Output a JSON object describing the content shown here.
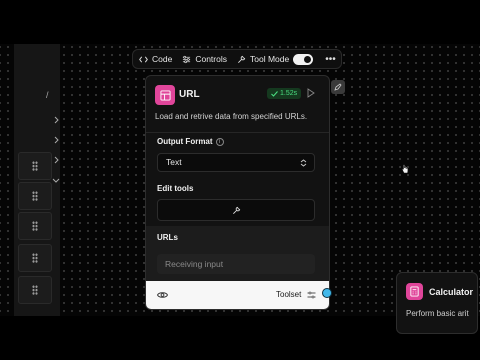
{
  "sidebar": {
    "slash": "/"
  },
  "toolbar": {
    "code_label": "Code",
    "controls_label": "Controls",
    "tool_mode_label": "Tool Mode",
    "tool_mode_on": true,
    "more": "•••"
  },
  "node": {
    "title": "URL",
    "run_time": "1.52s",
    "description": "Load and retrive data from specified URLs.",
    "output_format": {
      "label": "Output Format",
      "value": "Text"
    },
    "edit_tools": {
      "label": "Edit tools"
    },
    "urls": {
      "label": "URLs",
      "placeholder": "Receiving input"
    },
    "footer": {
      "toolset_label": "Toolset"
    }
  },
  "calculator": {
    "title": "Calculator",
    "description": "Perform basic arit"
  },
  "colors": {
    "accent_pink": "#e0459a",
    "success_green": "#4ade80",
    "handle_blue": "#41b8ea"
  }
}
